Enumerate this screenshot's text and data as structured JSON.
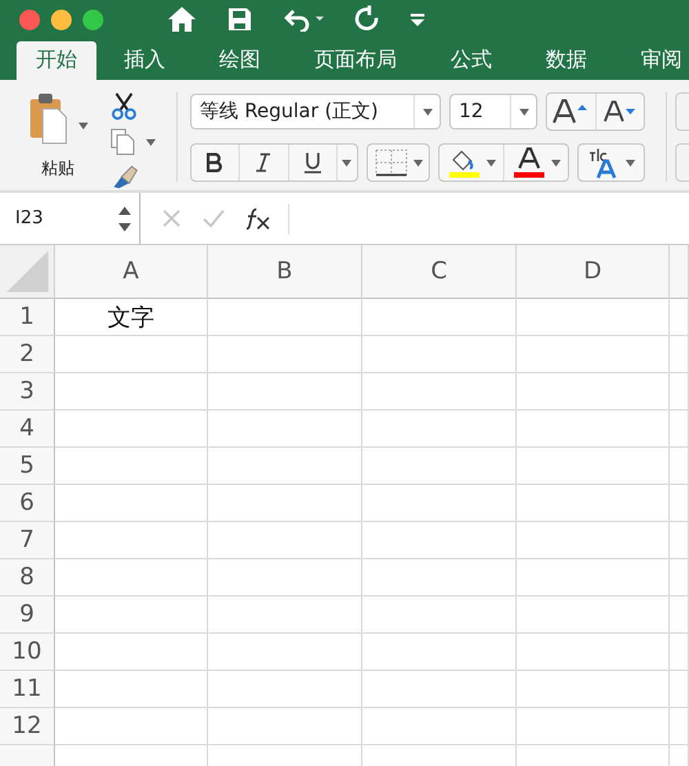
{
  "tabs": [
    {
      "label": "开始",
      "selected": true
    },
    {
      "label": "插入",
      "selected": false
    },
    {
      "label": "绘图",
      "selected": false
    },
    {
      "label": "页面布局",
      "selected": false
    },
    {
      "label": "公式",
      "selected": false
    },
    {
      "label": "数据",
      "selected": false
    },
    {
      "label": "审阅",
      "selected": false
    }
  ],
  "ribbon": {
    "paste_label": "粘贴",
    "font_name": "等线 Regular (正文)",
    "font_size": "12"
  },
  "name_box": "I23",
  "columns": [
    "A",
    "B",
    "C",
    "D"
  ],
  "rows": [
    {
      "number": "1",
      "values": [
        "文字"
      ]
    },
    {
      "number": "2",
      "values": []
    },
    {
      "number": "3",
      "values": []
    },
    {
      "number": "4",
      "values": []
    },
    {
      "number": "5",
      "values": []
    },
    {
      "number": "6",
      "values": []
    },
    {
      "number": "7",
      "values": []
    },
    {
      "number": "8",
      "values": []
    },
    {
      "number": "9",
      "values": []
    },
    {
      "number": "10",
      "values": []
    },
    {
      "number": "11",
      "values": []
    },
    {
      "number": "12",
      "values": []
    }
  ]
}
